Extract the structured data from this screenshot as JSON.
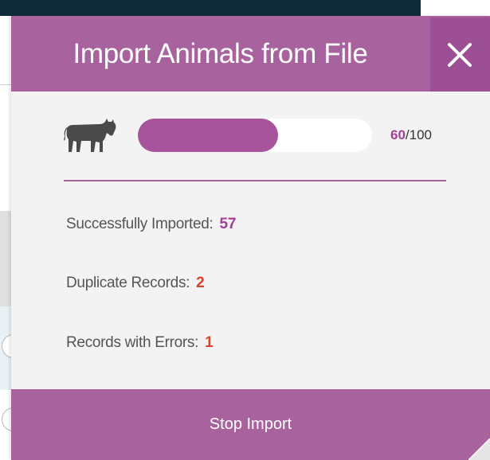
{
  "modal": {
    "title": "Import Animals from File",
    "close_icon": "close-icon",
    "animal_icon": "cow-icon",
    "progress": {
      "current": "60",
      "total": "/100",
      "fraction": 0.6
    },
    "stats": [
      {
        "label": "Successfully Imported:",
        "value": "57",
        "color": "#a23e93"
      },
      {
        "label": "Duplicate Records:",
        "value": "2",
        "color": "#e0412b"
      },
      {
        "label": "Records with Errors:",
        "value": "1",
        "color": "#e0412b"
      }
    ],
    "stop_label": "Stop Import"
  },
  "colors": {
    "header": "#a8639f",
    "close_bg": "#9d4f95",
    "progress_fill": "#a8549c",
    "accent_purple": "#a23e93",
    "accent_red": "#e0412b",
    "topbar": "#0f2a38"
  }
}
